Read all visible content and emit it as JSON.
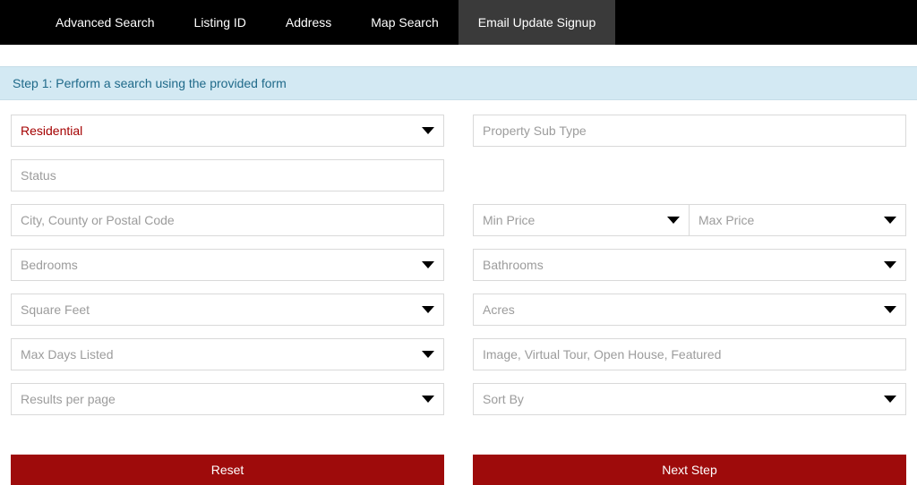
{
  "nav": {
    "items": [
      {
        "label": "Advanced Search",
        "active": false
      },
      {
        "label": "Listing ID",
        "active": false
      },
      {
        "label": "Address",
        "active": false
      },
      {
        "label": "Map Search",
        "active": false
      },
      {
        "label": "Email Update Signup",
        "active": true
      }
    ]
  },
  "banner": {
    "text": "Step 1: Perform a search using the provided form"
  },
  "fields": {
    "property_type": {
      "value": "Residential"
    },
    "property_sub_type": {
      "placeholder": "Property Sub Type"
    },
    "status": {
      "placeholder": "Status"
    },
    "location": {
      "placeholder": "City, County or Postal Code"
    },
    "min_price": {
      "placeholder": "Min Price"
    },
    "max_price": {
      "placeholder": "Max Price"
    },
    "bedrooms": {
      "placeholder": "Bedrooms"
    },
    "bathrooms": {
      "placeholder": "Bathrooms"
    },
    "square_feet": {
      "placeholder": "Square Feet"
    },
    "acres": {
      "placeholder": "Acres"
    },
    "max_days": {
      "placeholder": "Max Days Listed"
    },
    "features": {
      "placeholder": "Image, Virtual Tour, Open House, Featured"
    },
    "results_per_page": {
      "placeholder": "Results per page"
    },
    "sort_by": {
      "placeholder": "Sort By"
    }
  },
  "buttons": {
    "reset": "Reset",
    "next": "Next Step"
  }
}
